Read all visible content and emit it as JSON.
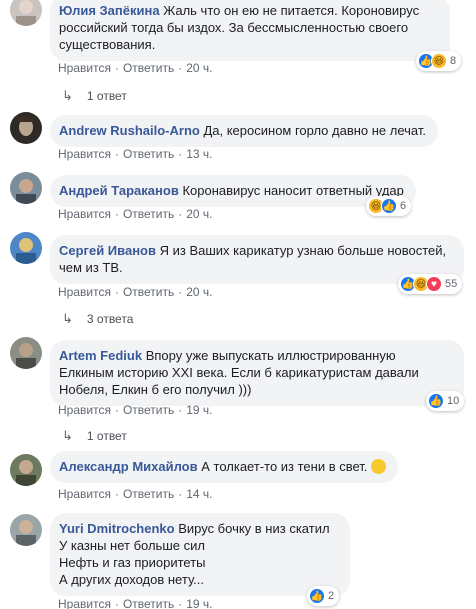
{
  "labels": {
    "like": "Нравится",
    "reply": "Ответить",
    "dot": "·"
  },
  "comments": [
    {
      "author": "Юлия Запёкина",
      "text": "Жаль что он ею не питается. Короновирус российский тогда бы издох. За бессмысленностью своего существования.",
      "time": "20 ч.",
      "reactions": [
        "like",
        "haha"
      ],
      "reaction_count": "8"
    },
    {
      "author": "Andrew Rushailo-Arno",
      "text": "Да, керосином горло давно не лечат.",
      "time": "13 ч."
    },
    {
      "author": "Андрей Тараканов",
      "text": "Коронавирус наносит ответный удар",
      "time": "20 ч.",
      "reactions": [
        "haha",
        "like"
      ],
      "reaction_count": "6"
    },
    {
      "author": "Сергей Иванов",
      "text": "Я из Ваших карикатур узнаю больше новостей, чем из ТВ.",
      "time": "20 ч.",
      "reactions": [
        "like",
        "haha",
        "love"
      ],
      "reaction_count": "55"
    },
    {
      "author": "Artem Fediuk",
      "text": "Впору уже выпускать иллюстрированную Елкиным историю XXI века. Если б карикатуристам давали Нобеля, Елкин б его получил )))",
      "time": "19 ч.",
      "reactions": [
        "like"
      ],
      "reaction_count": "10"
    },
    {
      "author": "Александр Михайлов",
      "text": "А толкает-то из тени в свет.",
      "time": "14 ч."
    },
    {
      "author": "Yuri Dmitrochenko",
      "text_lines": [
        "Вирус бочку в низ скатил",
        "У казны нет больше сил",
        "Нефть и газ приоритеты",
        "А других доходов нету..."
      ],
      "time": "19 ч.",
      "reactions": [
        "like"
      ],
      "reaction_count": "2"
    }
  ],
  "replies": [
    {
      "label": "1 ответ"
    },
    {
      "label": "3 ответа"
    },
    {
      "label": "1 ответ"
    }
  ]
}
